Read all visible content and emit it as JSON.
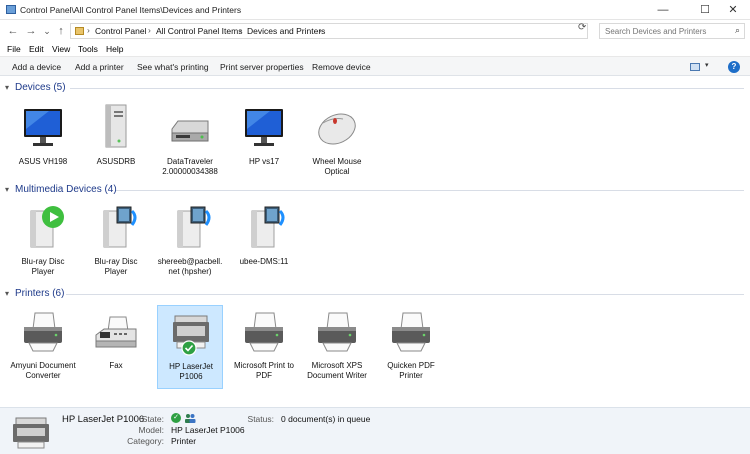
{
  "window": {
    "title": "Control Panel\\All Control Panel Items\\Devices and Printers",
    "minimize_glyph": "—",
    "maximize_glyph": "☐",
    "close_glyph": "✕"
  },
  "address": {
    "back_glyph": "←",
    "forward_glyph": "→",
    "history_glyph": "⌄",
    "up_glyph": "↑",
    "crumbs": [
      "Control Panel",
      "All Control Panel Items",
      "Devices and Printers"
    ],
    "separator": "›",
    "refresh_glyph": "⟳",
    "search_placeholder": "Search Devices and Printers",
    "search_glyph": "⌕"
  },
  "menu": [
    "File",
    "Edit",
    "View",
    "Tools",
    "Help"
  ],
  "commands": [
    "Add a device",
    "Add a printer",
    "See what's printing",
    "Print server properties",
    "Remove device"
  ],
  "help_glyph": "?",
  "view_chevron": "▾",
  "groups": {
    "devices": {
      "title": "Devices (5)",
      "items": [
        {
          "label": "ASUS VH198",
          "icon": "monitor-icon"
        },
        {
          "label": "ASUSDRB",
          "icon": "tower-computer-icon"
        },
        {
          "label": "DataTraveler 2.00000034388",
          "icon": "usb-drive-icon"
        },
        {
          "label": "HP vs17",
          "icon": "monitor-icon"
        },
        {
          "label": "Wheel Mouse Optical",
          "icon": "mouse-icon"
        }
      ]
    },
    "multimedia": {
      "title": "Multimedia Devices (4)",
      "items": [
        {
          "label": "Blu-ray Disc Player",
          "icon": "media-player-icon"
        },
        {
          "label": "Blu-ray Disc Player",
          "icon": "media-server-icon"
        },
        {
          "label": "shereeb@pacbell.net (hpsher)",
          "icon": "media-server-icon"
        },
        {
          "label": "ubee-DMS:11",
          "icon": "media-server-icon"
        }
      ]
    },
    "printers": {
      "title": "Printers (6)",
      "items": [
        {
          "label": "Amyuni Document Converter",
          "icon": "printer-icon"
        },
        {
          "label": "Fax",
          "icon": "fax-icon"
        },
        {
          "label": "HP LaserJet P1006",
          "icon": "laser-printer-icon",
          "selected": true
        },
        {
          "label": "Microsoft Print to PDF",
          "icon": "printer-icon"
        },
        {
          "label": "Microsoft XPS Document Writer",
          "icon": "printer-icon"
        },
        {
          "label": "Quicken PDF Printer",
          "icon": "printer-icon"
        }
      ]
    }
  },
  "details": {
    "name": "HP LaserJet P1006",
    "state_label": "State:",
    "model_label": "Model:",
    "model_value": "HP LaserJet P1006",
    "category_label": "Category:",
    "category_value": "Printer",
    "status_label": "Status:",
    "status_value": "0 document(s) in queue"
  },
  "colors": {
    "group_title": "#1e3a8a",
    "selection": "#cde8ff",
    "status_ok": "#2ea043"
  }
}
